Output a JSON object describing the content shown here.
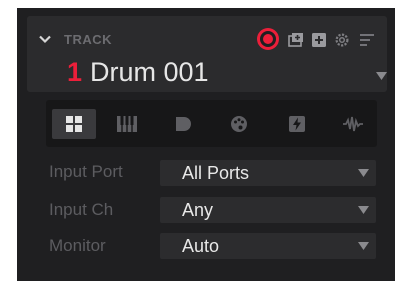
{
  "track": {
    "section_label": "TRACK",
    "number": "1",
    "name": "Drum 001",
    "accent_color": "#ec1f3a"
  },
  "header_icons": [
    "record-arm-icon",
    "add-track-icon",
    "add-plus-icon",
    "settings-gear-icon",
    "menu-lines-icon"
  ],
  "tabs": [
    {
      "id": "pads",
      "icon": "pad-grid-icon",
      "active": true
    },
    {
      "id": "keys",
      "icon": "keyboard-icon",
      "active": false
    },
    {
      "id": "plugin",
      "icon": "plugin-icon",
      "active": false
    },
    {
      "id": "color",
      "icon": "palette-icon",
      "active": false
    },
    {
      "id": "fx",
      "icon": "lightning-icon",
      "active": false
    },
    {
      "id": "audio",
      "icon": "waveform-icon",
      "active": false
    }
  ],
  "fields": {
    "input_port": {
      "label": "Input Port",
      "value": "All Ports"
    },
    "input_ch": {
      "label": "Input Ch",
      "value": "Any"
    },
    "monitor": {
      "label": "Monitor",
      "value": "Auto"
    }
  }
}
